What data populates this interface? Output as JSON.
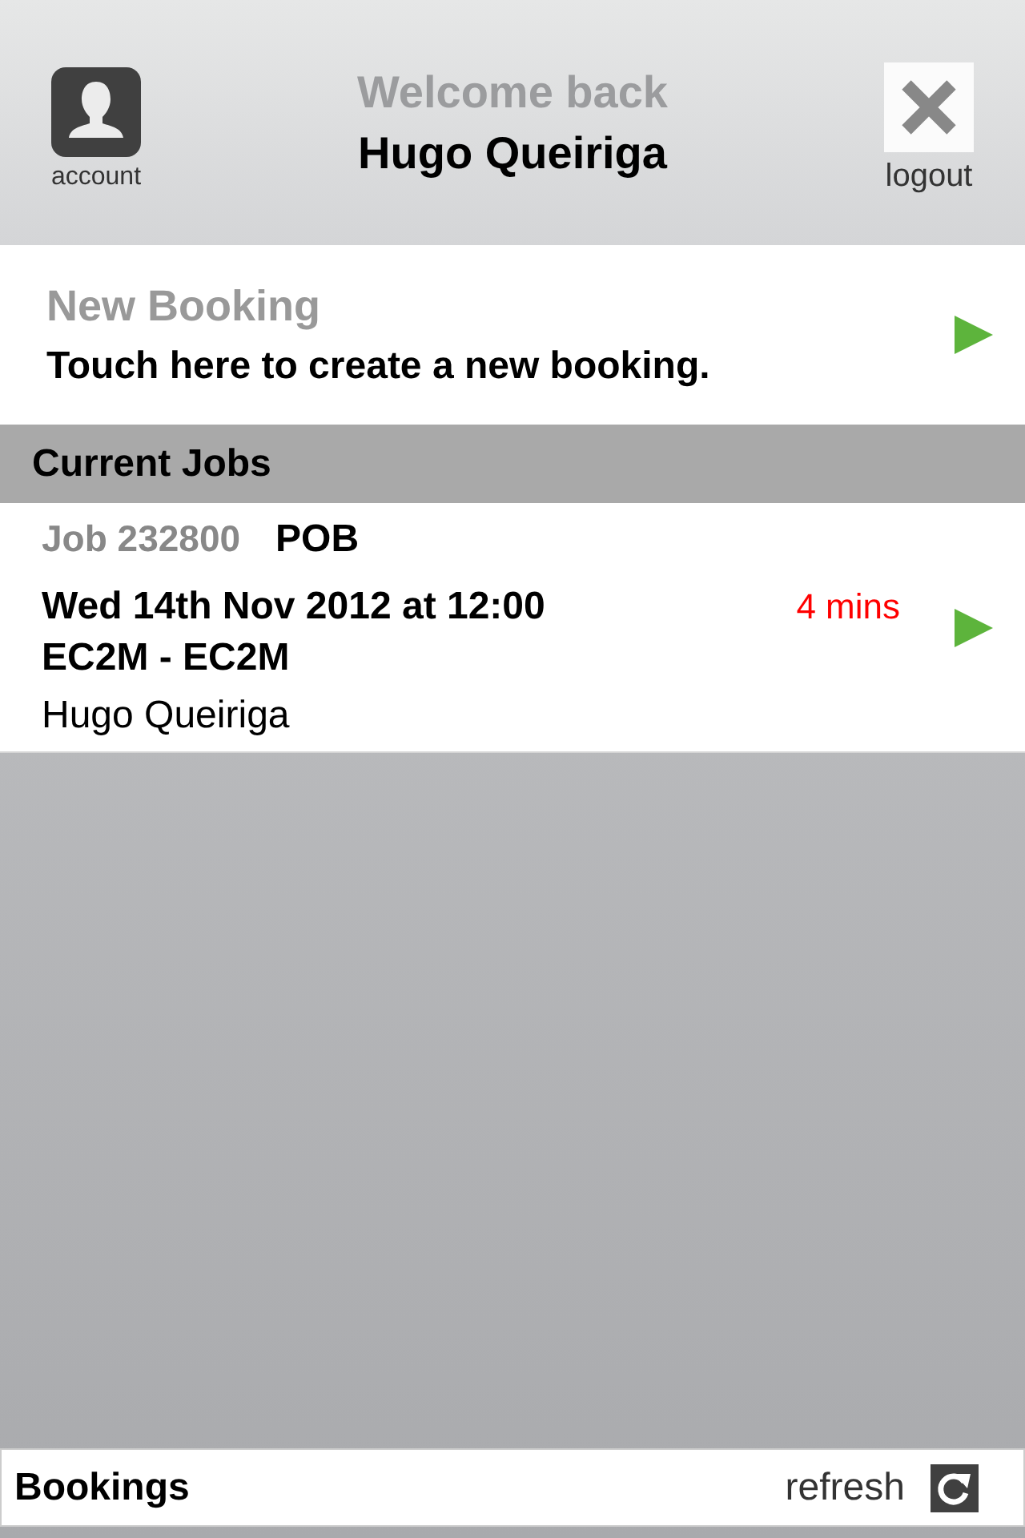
{
  "header": {
    "account_label": "account",
    "greeting": "Welcome back",
    "user_name": "Hugo Queiriga",
    "logout_label": "logout"
  },
  "new_booking": {
    "title": "New Booking",
    "subtitle": "Touch here to create a new booking."
  },
  "section_title": "Current Jobs",
  "jobs": [
    {
      "job_number": "Job 232800",
      "status": "POB",
      "datetime": "Wed 14th Nov 2012 at 12:00",
      "eta": "4 mins",
      "route": "EC2M - EC2M",
      "passenger": "Hugo Queiriga"
    }
  ],
  "footer": {
    "title": "Bookings",
    "refresh_label": "refresh"
  }
}
